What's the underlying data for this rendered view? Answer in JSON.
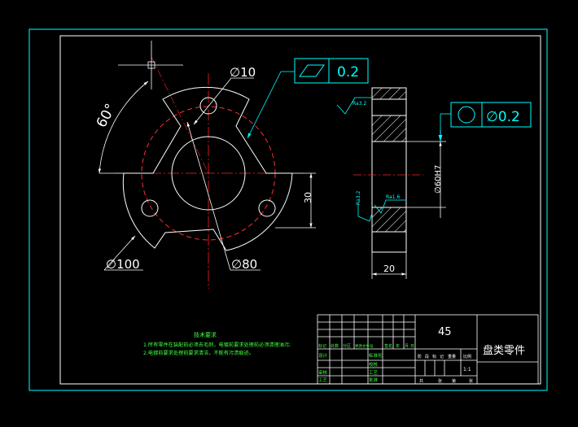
{
  "colors": {
    "background": "#000000",
    "frame": "#00ffff",
    "outline": "#ffffff",
    "centerline": "#ff2020",
    "hidden": "#ff3030",
    "dimension": "#ffffff",
    "annotation": "#00ffff",
    "notes": "#40ff40",
    "tolerance_text": "#00ffff"
  },
  "front_view": {
    "angle_label": "60°",
    "hole_label": "∅10",
    "outer_label": "∅100",
    "bore_label": "∅80",
    "offset_label": "30"
  },
  "tolerances": {
    "flatness_value": "0.2",
    "coaxiality_value": "∅0.2"
  },
  "section_view": {
    "bore_fit_label": "∅60H7",
    "width_label": "20",
    "roughness_top": "Ra3.2",
    "roughness_left": "Ra3.2",
    "roughness_mid": "Ra1.6"
  },
  "notes": {
    "title": "技术要求",
    "line1": "1.所有零件在装配前必须去毛刺，电镀前要求处理前必须清理油污;",
    "line2": "2.电镀前要求处理前要求清洁，不能有污渍痕迹。"
  },
  "title_block": {
    "material": "45",
    "part_name": "盘类零件",
    "scale": "1:1",
    "rev_headers": [
      "标记",
      "处数",
      "分区",
      "更改文件号",
      "签名",
      "年",
      "月",
      "日"
    ],
    "row_design": "设计",
    "row_standard": "标准化",
    "row_review": "审核",
    "row_check": "校核",
    "row_craft": "工艺",
    "row_approve": "批准",
    "stage_headers": [
      "阶",
      "段",
      "标",
      "记",
      "重量",
      "比例"
    ],
    "sheet_labels": [
      "共",
      "张",
      "第",
      "张"
    ]
  }
}
